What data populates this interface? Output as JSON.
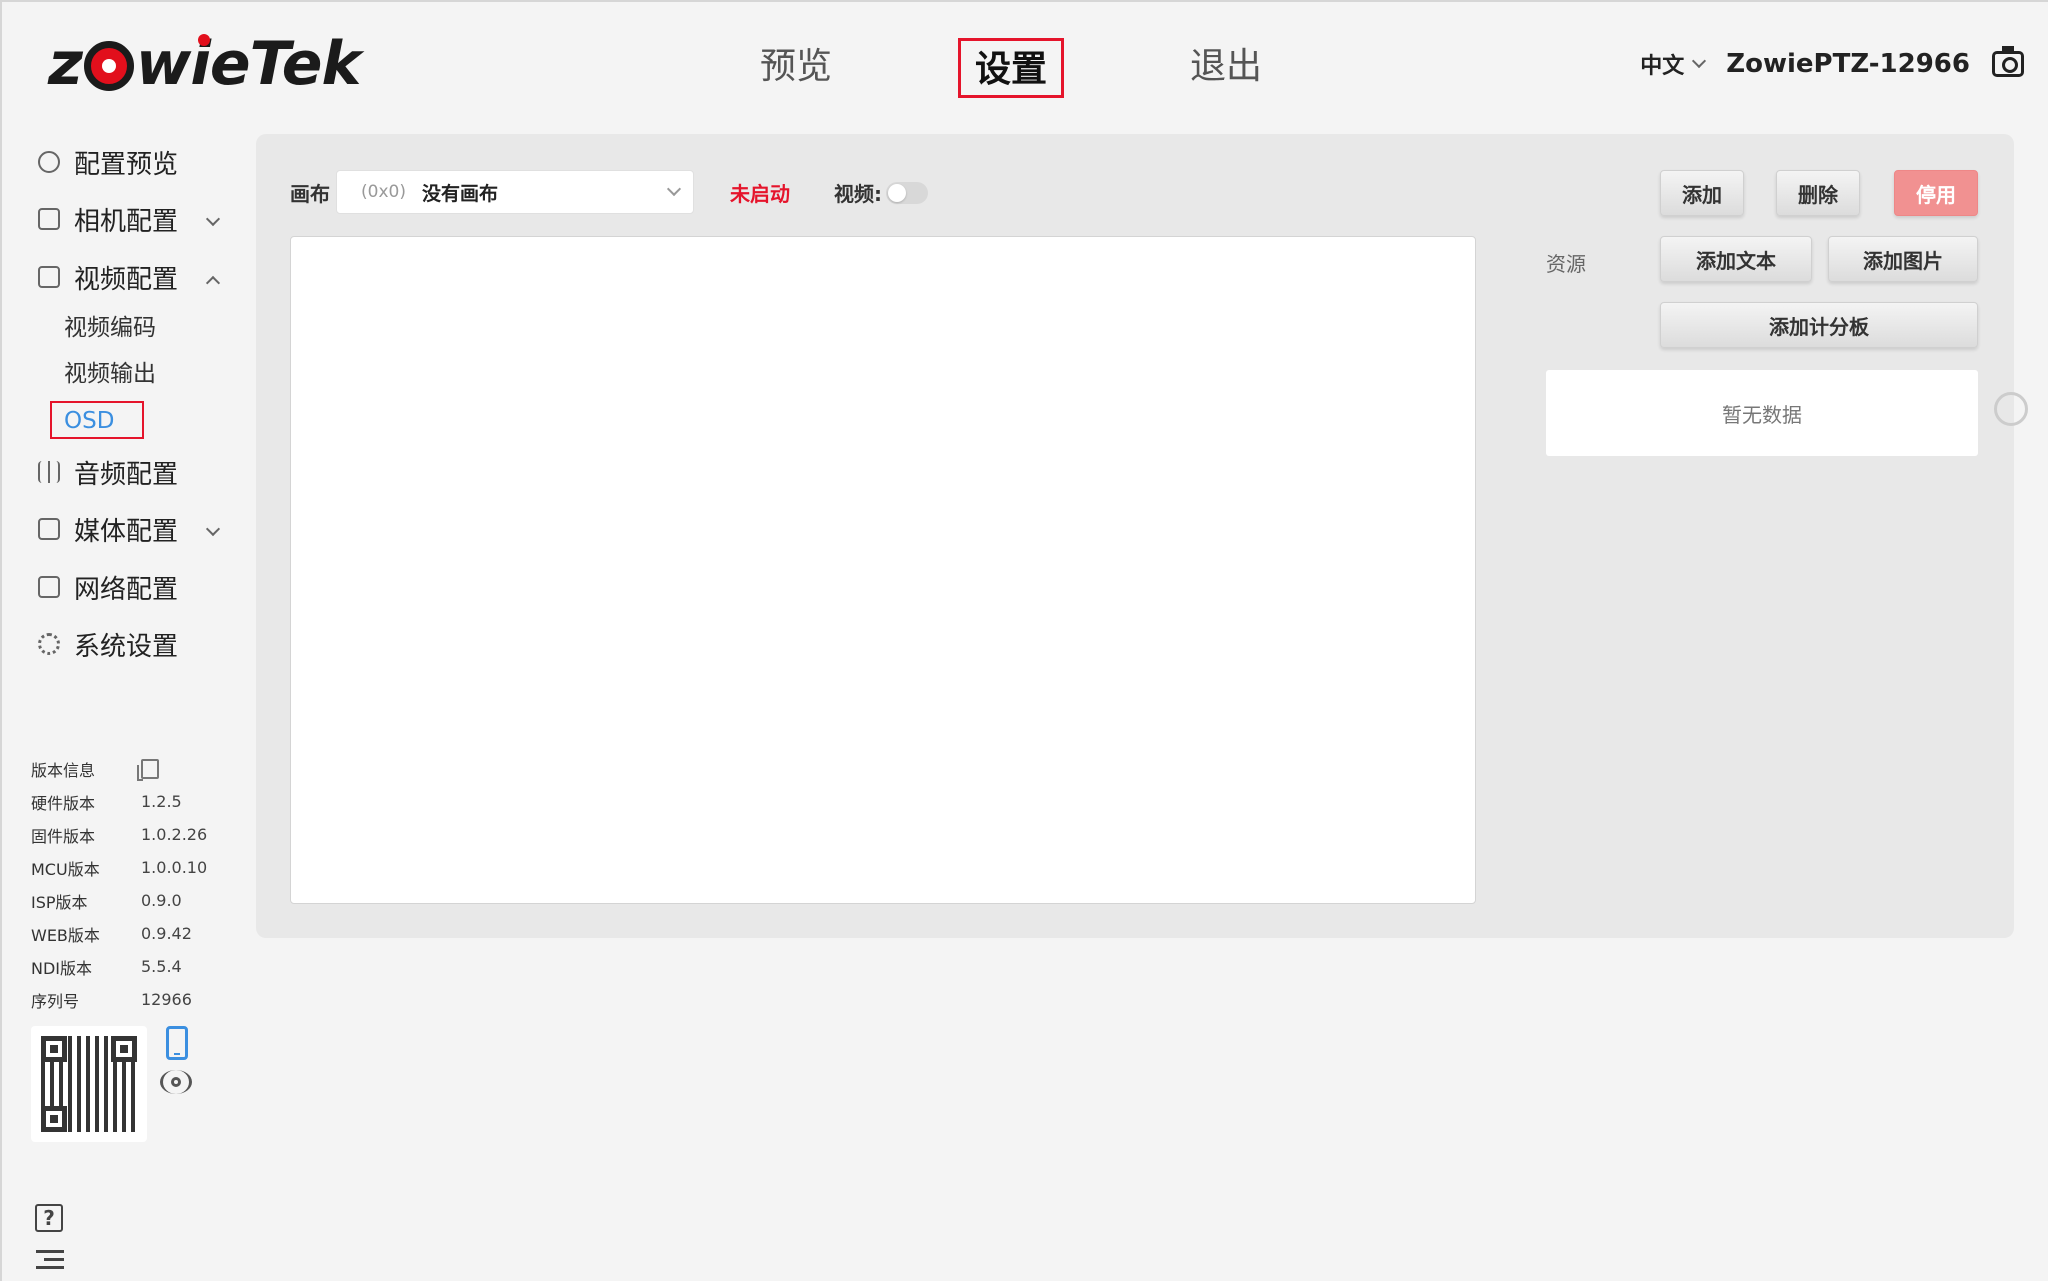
{
  "header": {
    "logo_text": "zowieTek",
    "nav": [
      {
        "label": "预览"
      },
      {
        "label": "设置"
      },
      {
        "label": "退出"
      }
    ],
    "language": "中文",
    "device_name": "ZowiePTZ-12966"
  },
  "sidebar": {
    "menu": [
      {
        "label": "配置预览"
      },
      {
        "label": "相机配置"
      },
      {
        "label": "视频配置"
      },
      {
        "label": "音频配置"
      },
      {
        "label": "媒体配置"
      },
      {
        "label": "网络配置"
      },
      {
        "label": "系统设置"
      }
    ],
    "video_sub": [
      {
        "label": "视频编码"
      },
      {
        "label": "视频输出"
      },
      {
        "label": "OSD"
      }
    ],
    "version_title": "版本信息",
    "versions": [
      {
        "k": "硬件版本",
        "v": "1.2.5"
      },
      {
        "k": "固件版本",
        "v": "1.0.2.26"
      },
      {
        "k": "MCU版本",
        "v": "1.0.0.10"
      },
      {
        "k": "ISP版本",
        "v": "0.9.0"
      },
      {
        "k": "WEB版本",
        "v": "0.9.42"
      },
      {
        "k": "NDI版本",
        "v": "5.5.4"
      },
      {
        "k": "序列号",
        "v": "12966"
      }
    ]
  },
  "osd": {
    "canvas_label": "画布",
    "canvas_size": "(0x0)",
    "canvas_value": "没有画布",
    "status": "未启动",
    "video_label": "视频:",
    "add": "添加",
    "delete": "删除",
    "disable": "停用",
    "resource_label": "资源",
    "add_text": "添加文本",
    "add_image": "添加图片",
    "add_scoreboard": "添加计分板",
    "empty": "暂无数据"
  },
  "colors": {
    "accent_red": "#e5142b",
    "link_blue": "#3b8fe0",
    "danger_button": "#f19191"
  }
}
